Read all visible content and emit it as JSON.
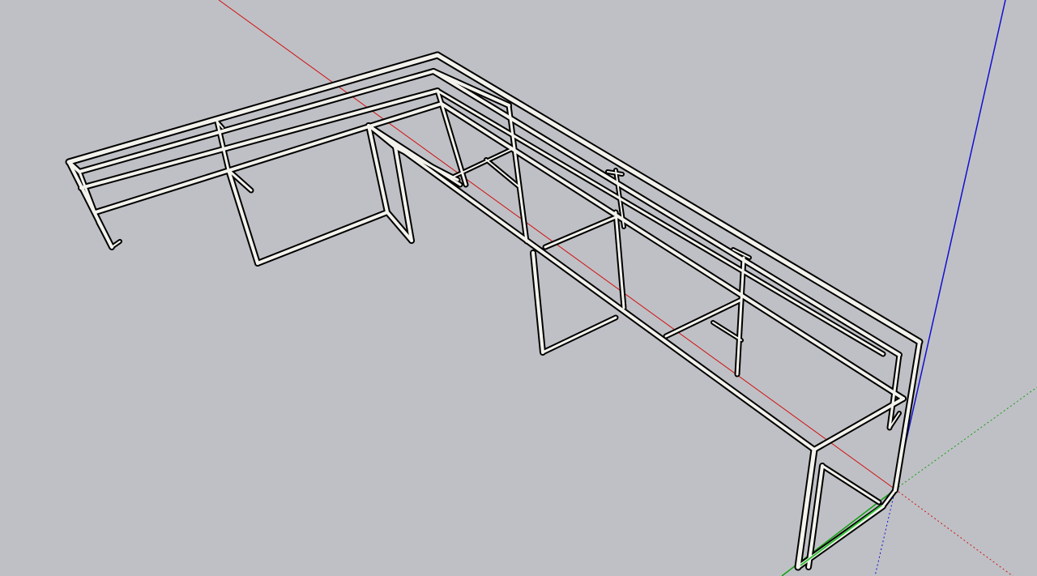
{
  "viewport": {
    "background_color": "#bfc0c5",
    "frame_fill_color": "#f3f2ec",
    "frame_edge_color": "#000000"
  },
  "axes": {
    "red": {
      "color": "#d01010",
      "style": "solid and dotted",
      "label": ""
    },
    "green": {
      "color": "#10a010",
      "style": "solid and dotted",
      "label": ""
    },
    "blue": {
      "color": "#1010d0",
      "style": "solid and dotted",
      "label": ""
    }
  },
  "model": {
    "kind": "L-shaped welded tube frame",
    "highlight_color": "#36c03a"
  }
}
